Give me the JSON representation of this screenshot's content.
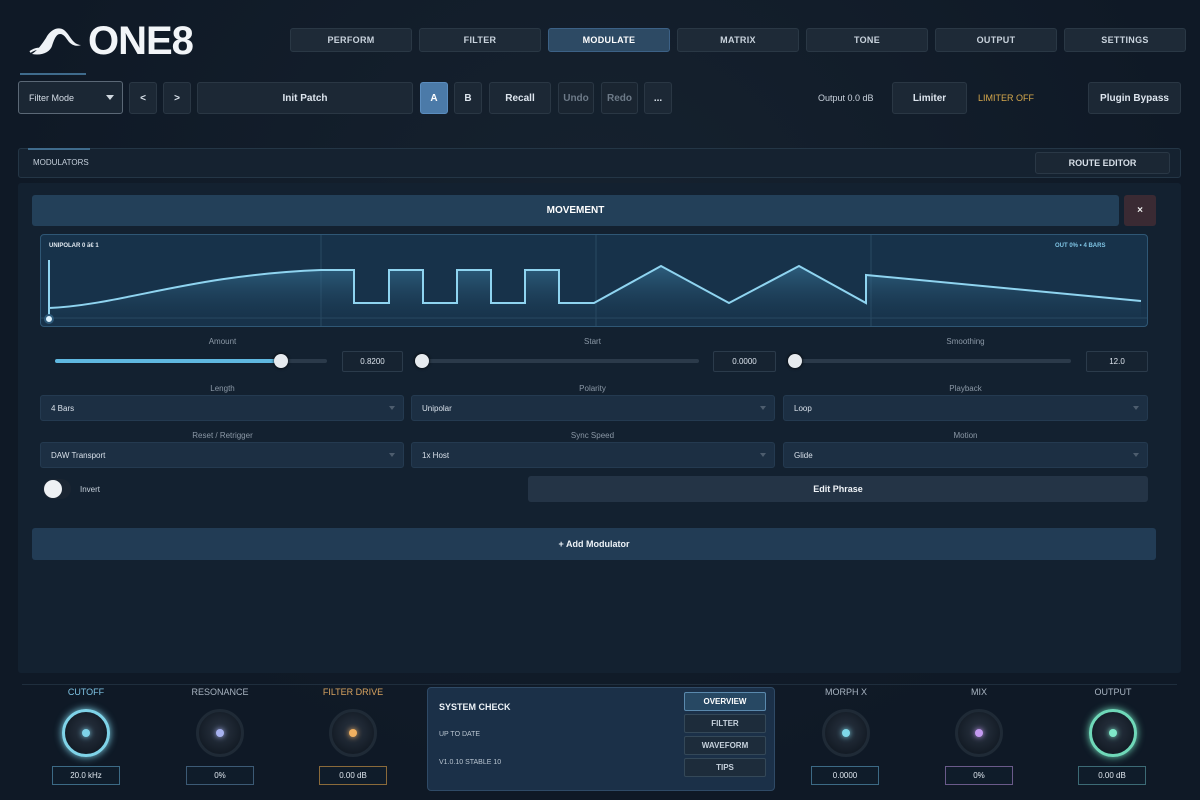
{
  "app": {
    "logo_text": "ONE8"
  },
  "nav": {
    "tabs": [
      "PERFORM",
      "FILTER",
      "MODULATE",
      "MATRIX",
      "TONE",
      "OUTPUT",
      "SETTINGS"
    ],
    "active": "MODULATE"
  },
  "toolbar": {
    "mode_select": "Filter Mode",
    "prev": "<",
    "next": ">",
    "patch_name": "Init Patch",
    "slot_a": "A",
    "slot_b": "B",
    "recall": "Recall",
    "undo": "Undo",
    "redo": "Redo",
    "more": "...",
    "output_level": "Output 0.0 dB",
    "limiter": "Limiter",
    "limiter_status": "LIMITER OFF",
    "plugin_bypass": "Plugin Bypass"
  },
  "modulators": {
    "tab_label": "MODULATORS",
    "route_editor": "ROUTE EDITOR",
    "movement_title": "MOVEMENT",
    "close": "×",
    "wave": {
      "left_info": "UNIPOLAR  0 ã€ 1",
      "right_info": "OUT 0%  •  4 BARS"
    },
    "sliders": [
      {
        "label": "Amount",
        "value": "0.8200",
        "fill": 0.83
      },
      {
        "label": "Start",
        "value": "0.0000",
        "fill": 0.0
      },
      {
        "label": "Smoothing",
        "value": "12.0",
        "fill": 0.0
      }
    ],
    "dropdowns": [
      {
        "label": "Length",
        "value": "4 Bars"
      },
      {
        "label": "Polarity",
        "value": "Unipolar"
      },
      {
        "label": "Playback",
        "value": "Loop"
      },
      {
        "label": "Reset / Retrigger",
        "value": "DAW Transport"
      },
      {
        "label": "Sync Speed",
        "value": "1x Host"
      },
      {
        "label": "Motion",
        "value": "Glide"
      }
    ],
    "invert": "Invert",
    "edit_phrase": "Edit Phrase",
    "add_modulator": "+ Add Modulator"
  },
  "bottom": {
    "knobs": [
      {
        "label": "CUTOFF",
        "value": "20.0 kHz",
        "label_color": "#7fc4e4",
        "dot": "#7fd3e8",
        "ring": "#7fd3e8",
        "box": "#3c6a85"
      },
      {
        "label": "RESONANCE",
        "value": "0%",
        "label_color": "#a8b4c1",
        "dot": "#a7b2f0",
        "ring": "",
        "box": "#3c5a75"
      },
      {
        "label": "FILTER DRIVE",
        "value": "0.00 dB",
        "label_color": "#d9a460",
        "dot": "#f0b060",
        "ring": "",
        "box": "#8a6a3a"
      },
      {
        "label": "MORPH X",
        "value": "0.0000",
        "label_color": "#a8b4c1",
        "dot": "#7fd8e8",
        "ring": "",
        "box": "#3c6a85"
      },
      {
        "label": "MIX",
        "value": "0%",
        "label_color": "#a8b4c1",
        "dot": "#c49af0",
        "ring": "",
        "box": "#6a5a8a"
      },
      {
        "label": "OUTPUT",
        "value": "0.00 dB",
        "label_color": "#a8b4c1",
        "dot": "#7fe8c8",
        "ring": "#6fd8b8",
        "box": "#3c6a75"
      }
    ],
    "system_check": {
      "title": "SYSTEM CHECK",
      "status": "UP TO DATE",
      "version": "V1.0.10 STABLE 10",
      "buttons": [
        "OVERVIEW",
        "FILTER",
        "WAVEFORM",
        "TIPS"
      ]
    }
  }
}
